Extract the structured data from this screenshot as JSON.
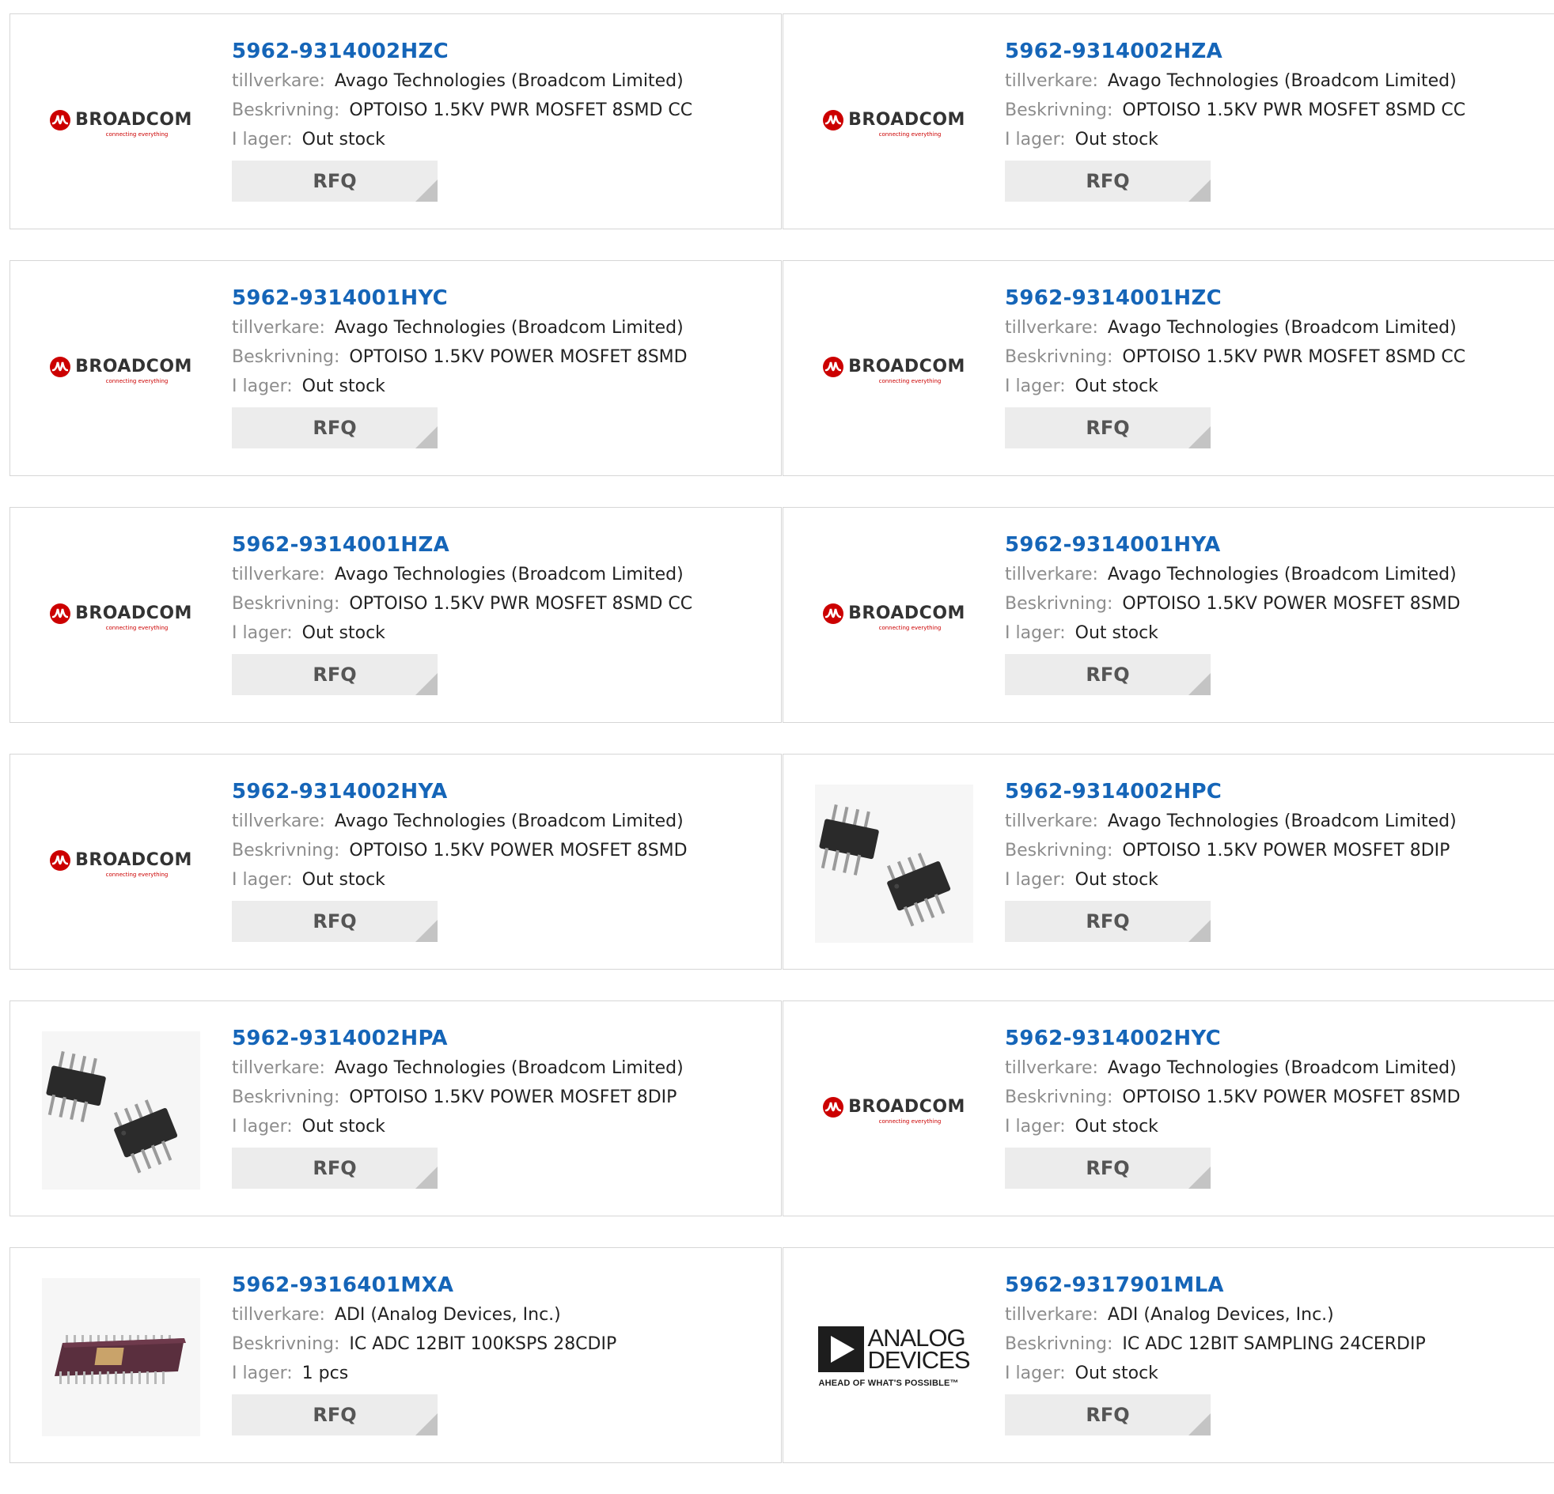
{
  "labels": {
    "manufacturer": "tillverkare:",
    "description": "Beskrivning:",
    "stock": "I lager:",
    "rfq": "RFQ"
  },
  "logos": {
    "broadcom": {
      "name": "BROADCOM",
      "tagline": "connecting everything"
    },
    "analog_devices": {
      "line1": "ANALOG",
      "line2": "DEVICES",
      "tagline": "AHEAD OF WHAT'S POSSIBLE™"
    }
  },
  "colors": {
    "link": "#1565b8",
    "broadcom_red": "#cc0000",
    "rfq_bg": "#ececec"
  },
  "products": [
    {
      "part": "5962-9314002HZC",
      "manufacturer": "Avago Technologies (Broadcom Limited)",
      "description": "OPTOISO 1.5KV PWR MOSFET 8SMD CC",
      "stock": "Out stock",
      "image": "broadcom-logo"
    },
    {
      "part": "5962-9314002HZA",
      "manufacturer": "Avago Technologies (Broadcom Limited)",
      "description": "OPTOISO 1.5KV PWR MOSFET 8SMD CC",
      "stock": "Out stock",
      "image": "broadcom-logo"
    },
    {
      "part": "5962-9314001HYC",
      "manufacturer": "Avago Technologies (Broadcom Limited)",
      "description": "OPTOISO 1.5KV POWER MOSFET 8SMD",
      "stock": "Out stock",
      "image": "broadcom-logo"
    },
    {
      "part": "5962-9314001HZC",
      "manufacturer": "Avago Technologies (Broadcom Limited)",
      "description": "OPTOISO 1.5KV PWR MOSFET 8SMD CC",
      "stock": "Out stock",
      "image": "broadcom-logo"
    },
    {
      "part": "5962-9314001HZA",
      "manufacturer": "Avago Technologies (Broadcom Limited)",
      "description": "OPTOISO 1.5KV PWR MOSFET 8SMD CC",
      "stock": "Out stock",
      "image": "broadcom-logo"
    },
    {
      "part": "5962-9314001HYA",
      "manufacturer": "Avago Technologies (Broadcom Limited)",
      "description": "OPTOISO 1.5KV POWER MOSFET 8SMD",
      "stock": "Out stock",
      "image": "broadcom-logo"
    },
    {
      "part": "5962-9314002HYA",
      "manufacturer": "Avago Technologies (Broadcom Limited)",
      "description": "OPTOISO 1.5KV POWER MOSFET 8SMD",
      "stock": "Out stock",
      "image": "broadcom-logo"
    },
    {
      "part": "5962-9314002HPC",
      "manufacturer": "Avago Technologies (Broadcom Limited)",
      "description": "OPTOISO 1.5KV POWER MOSFET 8DIP",
      "stock": "Out stock",
      "image": "dip-chips-photo"
    },
    {
      "part": "5962-9314002HPA",
      "manufacturer": "Avago Technologies (Broadcom Limited)",
      "description": "OPTOISO 1.5KV POWER MOSFET 8DIP",
      "stock": "Out stock",
      "image": "dip-chips-photo"
    },
    {
      "part": "5962-9314002HYC",
      "manufacturer": "Avago Technologies (Broadcom Limited)",
      "description": "OPTOISO 1.5KV POWER MOSFET 8SMD",
      "stock": "Out stock",
      "image": "broadcom-logo"
    },
    {
      "part": "5962-9316401MXA",
      "manufacturer": "ADI (Analog Devices, Inc.)",
      "description": "IC ADC 12BIT 100KSPS 28CDIP",
      "stock": "1 pcs",
      "image": "cdip-chip-photo"
    },
    {
      "part": "5962-9317901MLA",
      "manufacturer": "ADI (Analog Devices, Inc.)",
      "description": "IC ADC 12BIT SAMPLING 24CERDIP",
      "stock": "Out stock",
      "image": "analog-devices-logo"
    }
  ]
}
